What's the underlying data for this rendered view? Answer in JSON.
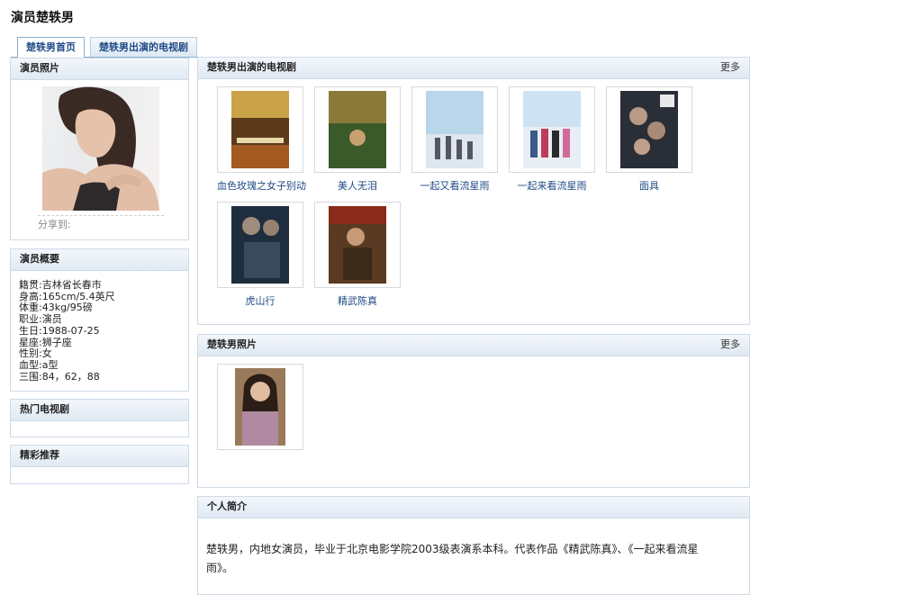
{
  "page": {
    "title": "演员楚轶男"
  },
  "tabs": [
    "楚轶男首页",
    "楚轶男出演的电视剧"
  ],
  "sidebar": {
    "photo_title": "演员照片",
    "share_label": "分享到:",
    "overview_title": "演员概要",
    "overview": [
      "籍贯:吉林省长春市",
      "身高:165cm/5.4英尺",
      "体重:43kg/95磅",
      "职业:演员",
      "生日:1988-07-25",
      "星座:狮子座",
      "性别:女",
      "血型:a型",
      "三围:84，62，88"
    ],
    "hot_tv_title": "热门电视剧",
    "recommend_title": "精彩推荐"
  },
  "tv_section": {
    "title": "楚轶男出演的电视剧",
    "more": "更多",
    "items": [
      "血色玫瑰之女子别动",
      "美人无泪",
      "一起又看流星雨",
      "一起来看流星雨",
      "面具",
      "虎山行",
      "精武陈真"
    ]
  },
  "photo_section": {
    "title": "楚轶男照片",
    "more": "更多"
  },
  "bio_section": {
    "title": "个人简介",
    "line1": "楚轶男，内地女演员，毕业于北京电影学院2003级表演系本科。代表作品《精武陈真》、《一起来看流星",
    "line2": "雨》。"
  },
  "colors": {
    "link": "#1f4a85",
    "header_bg": "#dfe9f3",
    "border": "#cfdbe8"
  }
}
